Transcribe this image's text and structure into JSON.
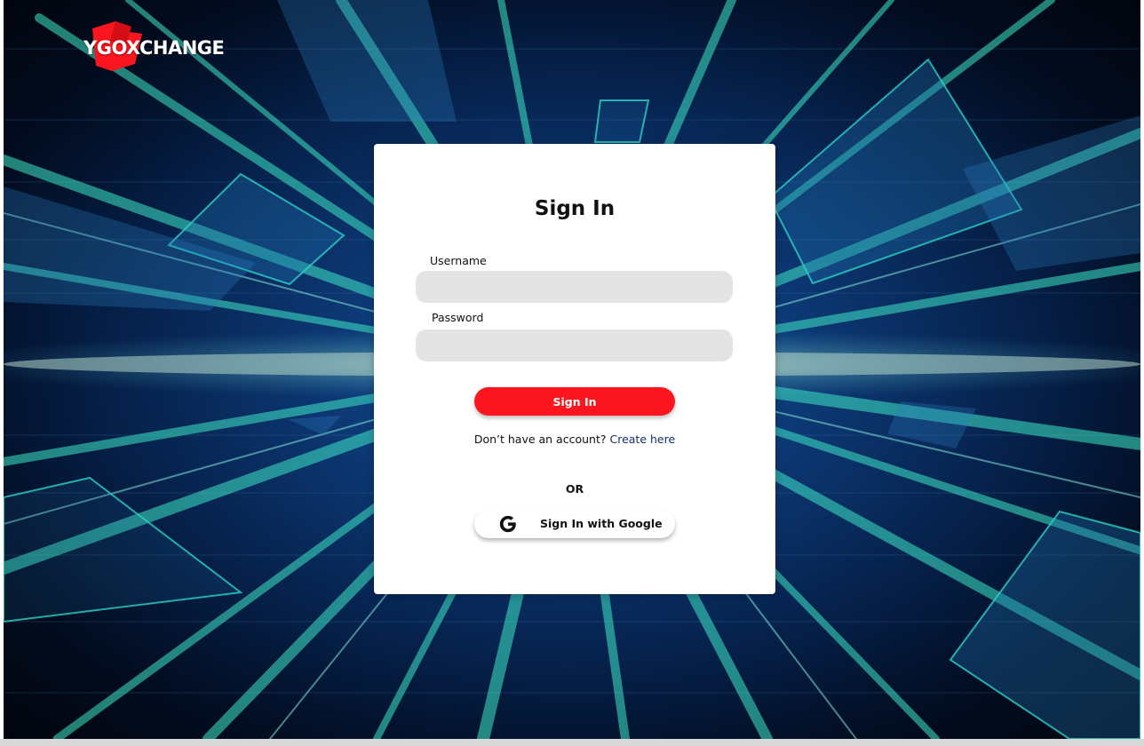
{
  "brand": {
    "name": "YGOXCHANGE",
    "accent_color": "#fb151f"
  },
  "login": {
    "title": "Sign In",
    "username_label": "Username",
    "username_value": "",
    "password_label": "Password",
    "password_value": "",
    "submit_label": "Sign In",
    "no_account_text": "Don’t have an account?",
    "create_link_label": "Create here",
    "divider_text": "OR",
    "google_label": "Sign In with Google",
    "google_icon": "google-g-icon"
  },
  "colors": {
    "link": "#12306b",
    "input_background": "#e4e4e4"
  }
}
